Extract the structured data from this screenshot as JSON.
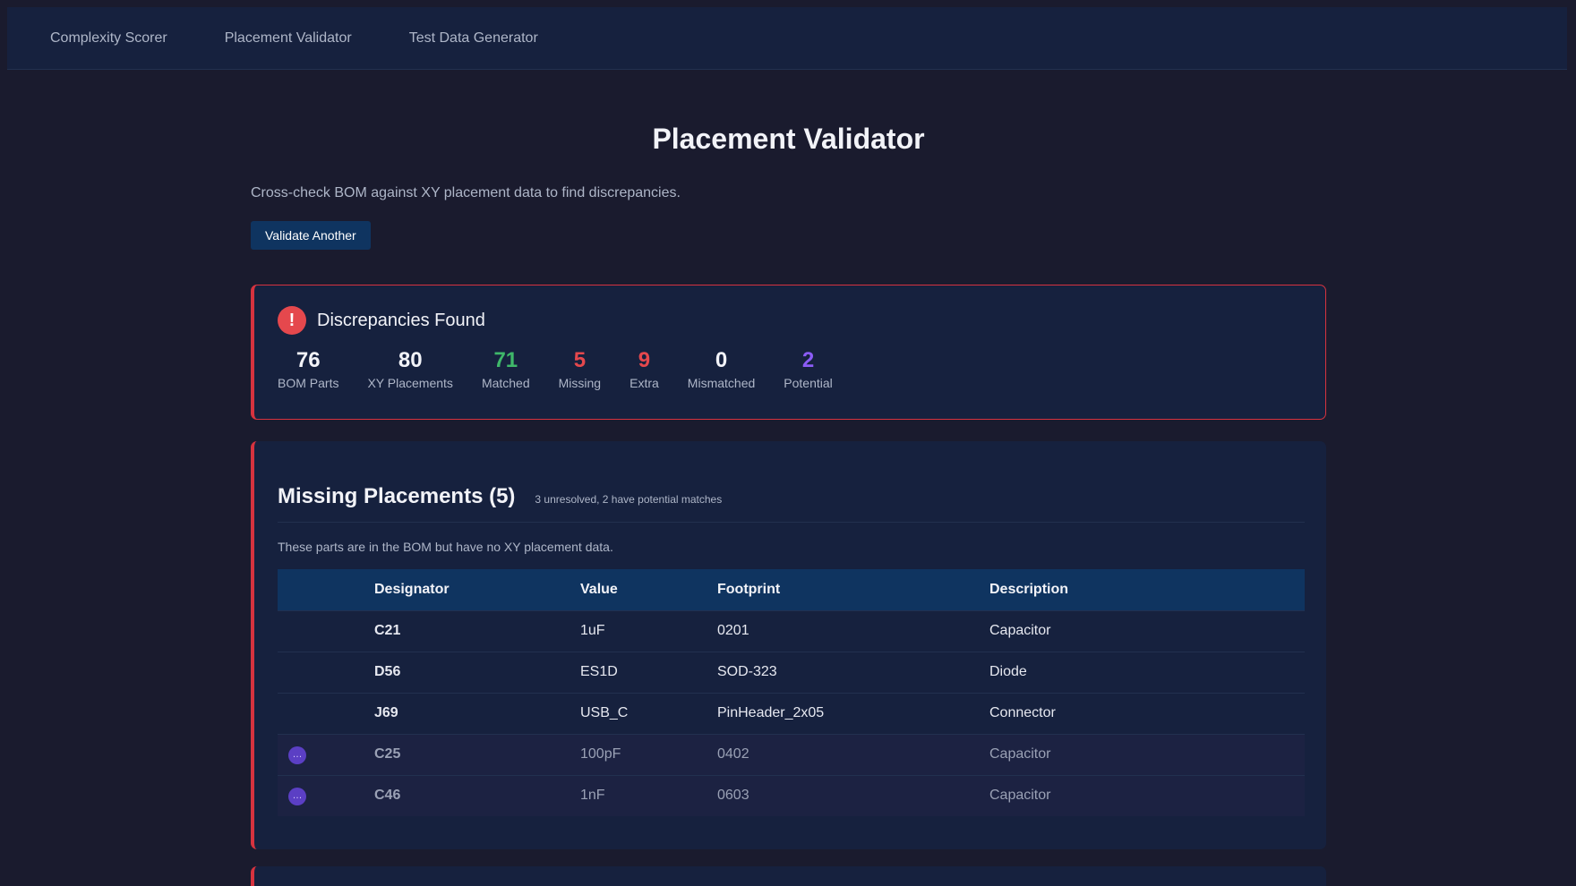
{
  "nav": {
    "items": [
      "Complexity Scorer",
      "Placement Validator",
      "Test Data Generator"
    ]
  },
  "page": {
    "title": "Placement Validator",
    "description": "Cross-check BOM against XY placement data to find discrepancies.",
    "validate_button": "Validate Another"
  },
  "summary": {
    "icon_glyph": "!",
    "title": "Discrepancies Found",
    "stats": [
      {
        "value": "76",
        "label": "BOM Parts",
        "color": "#f2f3f8"
      },
      {
        "value": "80",
        "label": "XY Placements",
        "color": "#f2f3f8"
      },
      {
        "value": "71",
        "label": "Matched",
        "color": "#3fb86a"
      },
      {
        "value": "5",
        "label": "Missing",
        "color": "#e5484d"
      },
      {
        "value": "9",
        "label": "Extra",
        "color": "#e5484d"
      },
      {
        "value": "0",
        "label": "Mismatched",
        "color": "#f2f3f8"
      },
      {
        "value": "2",
        "label": "Potential",
        "color": "#8b5cf6"
      }
    ]
  },
  "missing": {
    "title": "Missing Placements (5)",
    "subtitle": "3 unresolved, 2 have potential matches",
    "description": "These parts are in the BOM but have no XY placement data.",
    "columns": [
      "",
      "Designator",
      "Value",
      "Footprint",
      "Description"
    ],
    "potential_glyph": "…",
    "rows": [
      {
        "designator": "C21",
        "value": "1uF",
        "footprint": "0201",
        "description": "Capacitor",
        "potential": false
      },
      {
        "designator": "D56",
        "value": "ES1D",
        "footprint": "SOD-323",
        "description": "Diode",
        "potential": false
      },
      {
        "designator": "J69",
        "value": "USB_C",
        "footprint": "PinHeader_2x05",
        "description": "Connector",
        "potential": false
      },
      {
        "designator": "C25",
        "value": "100pF",
        "footprint": "0402",
        "description": "Capacitor",
        "potential": true
      },
      {
        "designator": "C46",
        "value": "1nF",
        "footprint": "0603",
        "description": "Capacitor",
        "potential": true
      }
    ]
  },
  "colors": {
    "background": "#1a1b2e",
    "card": "#16213e",
    "accent": "#0f3460",
    "error": "#e5484d",
    "success": "#3fb86a",
    "potential": "#8b5cf6"
  }
}
